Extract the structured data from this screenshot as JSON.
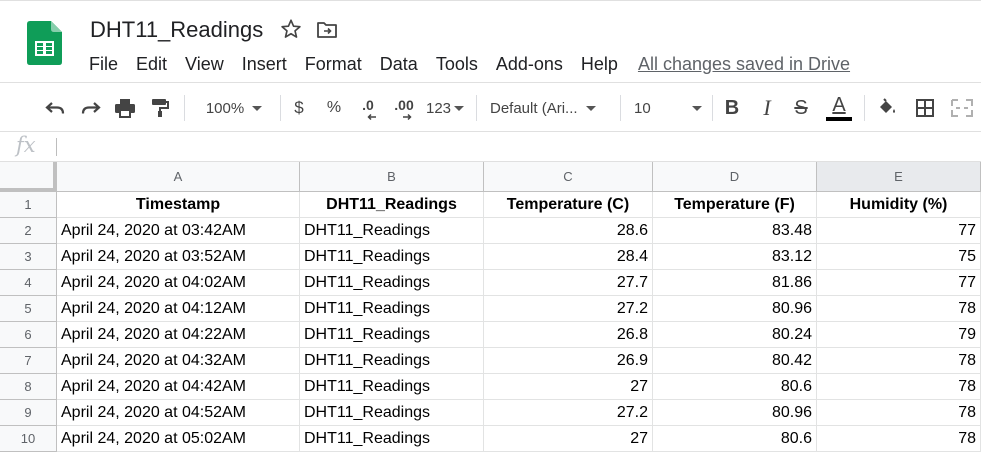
{
  "app": {
    "title": "DHT11_Readings",
    "save_status": "All changes saved in Drive",
    "brand_color": "#0f9d58"
  },
  "menu": [
    "File",
    "Edit",
    "View",
    "Insert",
    "Format",
    "Data",
    "Tools",
    "Add-ons",
    "Help"
  ],
  "toolbar": {
    "zoom": "100%",
    "currency": "$",
    "percent": "%",
    "decrease_decimal": ".0",
    "increase_decimal": ".00",
    "more_formats": "123",
    "font": "Default (Ari...",
    "font_size": "10",
    "bold": "B",
    "italic": "I",
    "strikethrough": "S",
    "text_color_letter": "A",
    "icons": [
      "undo-icon",
      "redo-icon",
      "print-icon",
      "paint-format-icon",
      "bold-icon",
      "italic-icon",
      "strikethrough-icon",
      "text-color-icon",
      "fill-color-icon",
      "borders-icon",
      "merge-cells-icon"
    ]
  },
  "formula_bar": {
    "label": "fx",
    "value": ""
  },
  "sheet": {
    "columns": [
      "A",
      "B",
      "C",
      "D",
      "E"
    ],
    "selected_column": "E",
    "row_numbers": [
      "1",
      "2",
      "3",
      "4",
      "5",
      "6",
      "7",
      "8",
      "9",
      "10"
    ],
    "header": [
      "Timestamp",
      "DHT11_Readings",
      "Temperature (C)",
      "Temperature (F)",
      "Humidity (%)"
    ],
    "rows": [
      [
        "April 24, 2020 at 03:42AM",
        "DHT11_Readings",
        "28.6",
        "83.48",
        "77"
      ],
      [
        "April 24, 2020 at 03:52AM",
        "DHT11_Readings",
        "28.4",
        "83.12",
        "75"
      ],
      [
        "April 24, 2020 at 04:02AM",
        "DHT11_Readings",
        "27.7",
        "81.86",
        "77"
      ],
      [
        "April 24, 2020 at 04:12AM",
        "DHT11_Readings",
        "27.2",
        "80.96",
        "78"
      ],
      [
        "April 24, 2020 at 04:22AM",
        "DHT11_Readings",
        "26.8",
        "80.24",
        "79"
      ],
      [
        "April 24, 2020 at 04:32AM",
        "DHT11_Readings",
        "26.9",
        "80.42",
        "78"
      ],
      [
        "April 24, 2020 at 04:42AM",
        "DHT11_Readings",
        "27",
        "80.6",
        "78"
      ],
      [
        "April 24, 2020 at 04:52AM",
        "DHT11_Readings",
        "27.2",
        "80.96",
        "78"
      ],
      [
        "April 24, 2020 at 05:02AM",
        "DHT11_Readings",
        "27",
        "80.6",
        "78"
      ]
    ]
  }
}
